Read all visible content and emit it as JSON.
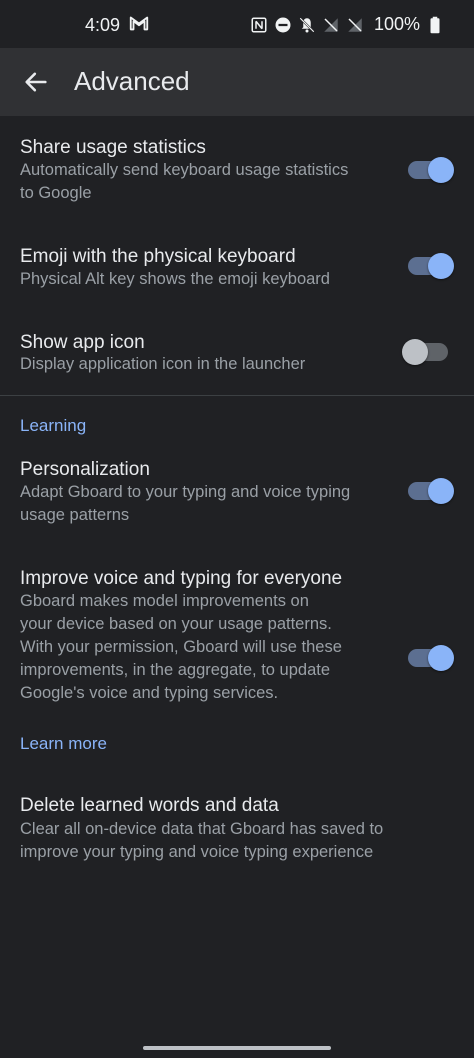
{
  "status_bar": {
    "time": "4:09",
    "battery": "100%",
    "icons": [
      "gmail-icon",
      "nfc-icon",
      "do-not-disturb-icon",
      "notifications-off-icon",
      "no-signal-icon",
      "no-signal-icon",
      "battery-full-icon"
    ]
  },
  "app_bar": {
    "back_icon": "arrow-back-icon",
    "title": "Advanced"
  },
  "settings": [
    {
      "title": "Share usage statistics",
      "summary_lines": [
        "Automatically send keyboard usage statistics",
        "to Google"
      ],
      "enabled": true
    },
    {
      "title": "Emoji with the physical keyboard",
      "summary_lines": [
        "Physical Alt key shows the emoji keyboard"
      ],
      "enabled": true
    },
    {
      "title": "Show app icon",
      "summary_lines": [
        "Display application icon in the launcher"
      ],
      "enabled": false
    }
  ],
  "learning": {
    "header": "Learning",
    "items": [
      {
        "title": "Personalization",
        "summary_lines": [
          "Adapt Gboard to your typing and voice typing",
          "usage patterns"
        ],
        "enabled": true
      },
      {
        "title": "Improve voice and typing for everyone",
        "summary_lines": [
          "Gboard makes model improvements on",
          "your device based on your usage patterns.",
          "With your permission, Gboard will use these",
          "improvements, in the aggregate, to update",
          "Google's voice and typing services."
        ],
        "enabled": true
      }
    ],
    "learn_more": "Learn more",
    "delete": {
      "title": "Delete learned words and data",
      "summary_lines": [
        "Clear all on-device data that Gboard has saved to",
        "improve your typing and voice typing experience"
      ]
    }
  },
  "colors": {
    "background": "#202124",
    "app_bar": "#303134",
    "accent": "#8ab4f8",
    "secondary_text": "#9aa0a6"
  }
}
